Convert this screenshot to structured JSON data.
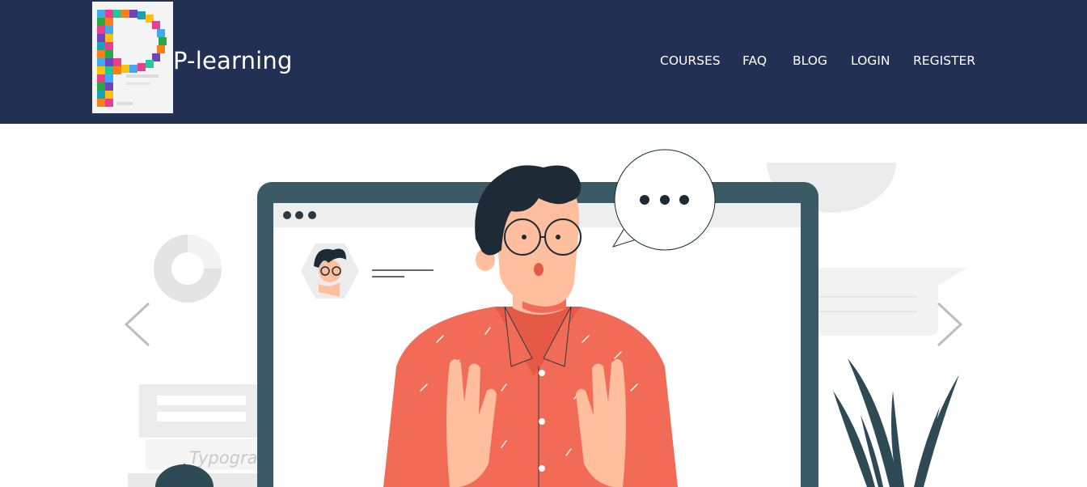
{
  "brand": {
    "name": "P-learning",
    "logo_icon": "letter-p-icon-collage"
  },
  "nav": {
    "items": [
      {
        "label": "COURSES"
      },
      {
        "label": "FAQ"
      },
      {
        "label": "BLOG"
      },
      {
        "label": "LOGIN"
      },
      {
        "label": "REGISTER"
      }
    ]
  },
  "carousel": {
    "prev_icon": "chevron-left-icon",
    "next_icon": "chevron-right-icon",
    "slide_text": "Typogra"
  },
  "colors": {
    "navbar_bg": "#213053",
    "shirt": "#f26b57",
    "monitor": "#3a5a65",
    "plant": "#2e4a55",
    "hair": "#1d2b36",
    "skin": "#ffbf9e"
  }
}
